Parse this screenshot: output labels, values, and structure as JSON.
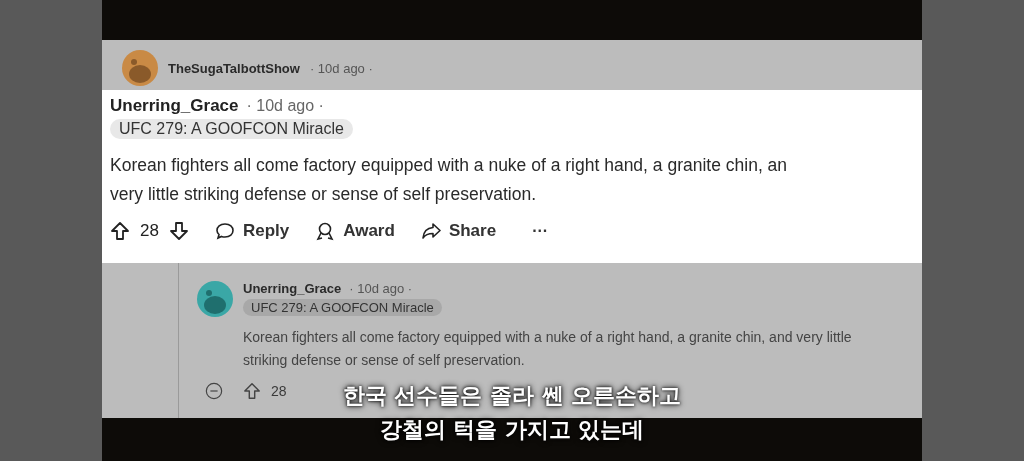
{
  "parent_comment": {
    "author": "TheSugaTalbottShow",
    "time": "· 10d ago ·"
  },
  "highlighted_comment": {
    "author": "Unerring_Grace",
    "time": "· 10d ago ·",
    "flair": "UFC 279: A GOOFCON Miracle",
    "body": "Korean fighters all come factory equipped with a nuke of a right hand, a granite chin, an",
    "body_line_2": "very little striking defense or sense of self preservation.",
    "votes": "28",
    "actions": [
      "Reply",
      "Award",
      "Share"
    ],
    "more": "···"
  },
  "reply_comment": {
    "author": "Unerring_Grace",
    "time": "· 10d ago ·",
    "flair": "UFC 279: A GOOFCON Miracle",
    "body": "Korean fighters all come factory equipped with a nuke of a right hand, a granite chin, and very little striking defense or sense of self preservation.",
    "votes": "28"
  },
  "subtitles": [
    "한국 선수들은 졸라 쎈 오른손하고",
    "강철의 턱을 가지고 있는데"
  ]
}
